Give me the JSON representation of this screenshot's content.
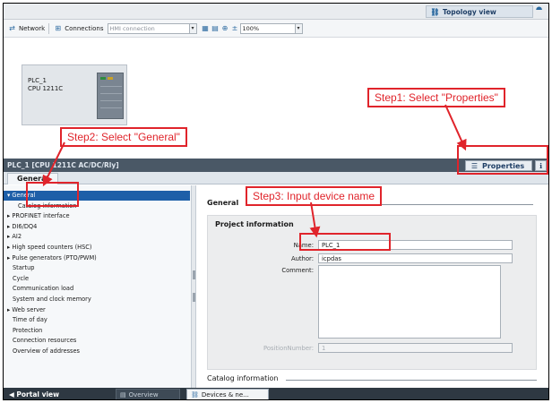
{
  "topbar": {
    "topology_view_label": "Topology view"
  },
  "toolbar": {
    "network_label": "Network",
    "connections_label": "Connections",
    "connection_type_value": "HMI connection",
    "zoom_value": "100%"
  },
  "device": {
    "name": "PLC_1",
    "cpu": "CPU 1211C"
  },
  "annotations": {
    "step1": "Step1: Select \"Properties\"",
    "step2": "Step2: Select \"General\"",
    "step3": "Step3: Input device name"
  },
  "properties": {
    "title": "PLC_1 [CPU 1211C AC/DC/Rly]",
    "tab_label": "Properties",
    "subtab": "General"
  },
  "nav": {
    "items": [
      {
        "label": "General",
        "prefix": "▾ "
      },
      {
        "label": "Catalog information",
        "prefix": ""
      },
      {
        "label": "PROFINET interface",
        "prefix": "▸ "
      },
      {
        "label": "DI6/DQ4",
        "prefix": "▸ "
      },
      {
        "label": "AI2",
        "prefix": "▸ "
      },
      {
        "label": "High speed counters (HSC)",
        "prefix": "▸ "
      },
      {
        "label": "Pulse generators (PTO/PWM)",
        "prefix": "▸ "
      },
      {
        "label": "Startup",
        "prefix": ""
      },
      {
        "label": "Cycle",
        "prefix": ""
      },
      {
        "label": "Communication load",
        "prefix": ""
      },
      {
        "label": "System and clock memory",
        "prefix": ""
      },
      {
        "label": "Web server",
        "prefix": "▸ "
      },
      {
        "label": "Time of day",
        "prefix": ""
      },
      {
        "label": "Protection",
        "prefix": ""
      },
      {
        "label": "Connection resources",
        "prefix": ""
      },
      {
        "label": "Overview of addresses",
        "prefix": ""
      }
    ]
  },
  "general": {
    "heading": "General",
    "project_info_title": "Project information",
    "name_label": "Name:",
    "name_value": "PLC_1",
    "author_label": "Author:",
    "author_value": "icpdas",
    "comment_label": "Comment:",
    "comment_value": "",
    "position_label": "PositionNumber:",
    "position_value": "1",
    "catalog_heading": "Catalog information"
  },
  "bottombar": {
    "portal_label": "Portal view",
    "overview_label": "Overview",
    "devices_label": "Devices & ne..."
  },
  "colors": {
    "annotation": "#e0242b",
    "selection": "#1e5fa8",
    "header": "#4a5866"
  }
}
